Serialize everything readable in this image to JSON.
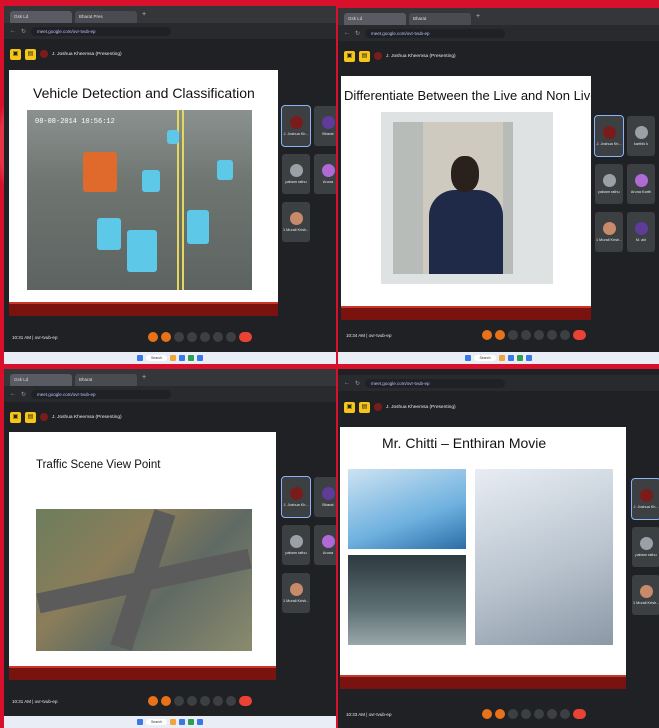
{
  "colors": {
    "background": "#d8102c",
    "meet_bg": "#202124",
    "slide_footer": "#7a1210",
    "end_call": "#ea4335"
  },
  "panels": [
    {
      "tabs": [
        "Gsk Ld",
        "Bharat Pres"
      ],
      "url": "meet.google.com/ovr-tvub-ep",
      "presenter": "J. Joshua Kheemsa (Presenting)",
      "slide_title": "Vehicle Detection and Classification",
      "timestamp": "08-08-2014 10:56:12",
      "participants": [
        "J. Joshua Kh...",
        "Bharat",
        "pabam rathu",
        "Aruna",
        "1 Murali Krish..."
      ],
      "time": "10:31 AM | ovr-tvub-ep"
    },
    {
      "tabs": [
        "Gsk Ld",
        "Bharat"
      ],
      "url": "meet.google.com/ovr-tvub-ep",
      "presenter": "J. Joshua Kheemsa (Presenting)",
      "slide_title": "Differentiate Between the Live and Non Live Face",
      "participants": [
        "J. Joshua Kh...",
        "karthik k",
        "pabam rathu",
        "Aruna Karth",
        "1 Murali Krish...",
        "M. abi"
      ],
      "time": "10:34 AM | ovr-tvub-ep"
    },
    {
      "tabs": [
        "Gsk Ld",
        "Bharat"
      ],
      "url": "meet.google.com/ovr-tvub-ep",
      "presenter": "J. Joshua Kheemsa (Presenting)",
      "slide_title": "Traffic Scene View Point",
      "participants": [
        "J. Joshua Kh...",
        "Bharat",
        "pabam rathu",
        "Aruna",
        "1 Murali Krish..."
      ],
      "time": "10:31 AM | ovr-tvub-ep"
    },
    {
      "tabs": [],
      "url": "meet.google.com/ovr-tvub-ep",
      "presenter": "J. Joshua Kheemsa (Presenting)",
      "slide_title": "Mr. Chitti – Enthiran Movie",
      "participants": [
        "J. Joshua Kh...",
        "pabam rathu",
        "1 Murali Krish..."
      ],
      "time": "10:33 AM | ovr-tvub-ep"
    }
  ],
  "icons": [
    "lock-icon",
    "mic-icon",
    "camera-icon",
    "present-icon",
    "end-call-icon",
    "search-icon"
  ],
  "taskbar": {
    "search_label": "Search"
  }
}
